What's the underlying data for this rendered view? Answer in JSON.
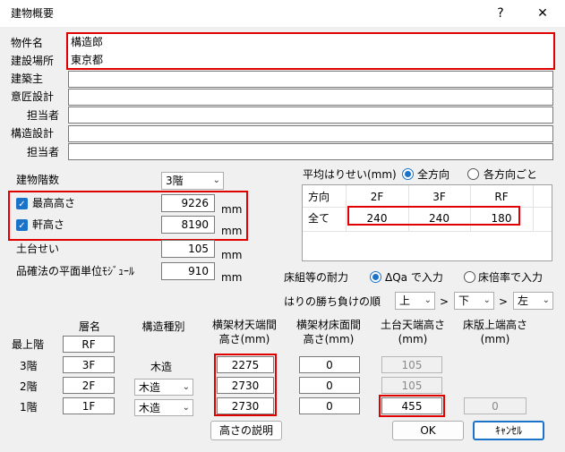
{
  "titlebar": {
    "title": "建物概要",
    "help": "?",
    "close": "✕"
  },
  "general": {
    "property_name_label": "物件名",
    "property_name_value": "構造郎",
    "location_label": "建設場所",
    "location_value": "東京都",
    "client_label": "建築主",
    "client_value": "",
    "design_label": "意匠設計",
    "design_value": "",
    "design_person_label": "担当者",
    "design_person_value": "",
    "structural_label": "構造設計",
    "structural_value": "",
    "structural_person_label": "担当者",
    "structural_person_value": ""
  },
  "building": {
    "floors_label": "建物階数",
    "floors_value": "3階",
    "max_height_label": "最高高さ",
    "max_height_value": "9226",
    "max_height_unit": "mm",
    "eave_height_label": "軒高さ",
    "eave_height_value": "8190",
    "eave_height_unit": "mm",
    "sill_label": "土台せい",
    "sill_value": "105",
    "sill_unit": "mm",
    "module_label": "品確法の平面単位ﾓｼﾞｭｰﾙ",
    "module_value": "910",
    "module_unit": "mm",
    "max_height_checked": true,
    "eave_height_checked": true
  },
  "beam_depth": {
    "label": "平均はりせい(mm)",
    "radio_all": "全方向",
    "radio_each": "各方向ごと",
    "selected": "all",
    "headers": [
      "方向",
      "2F",
      "3F",
      "RF"
    ],
    "row_label": "全て",
    "values": [
      "240",
      "240",
      "180"
    ]
  },
  "floor_strength": {
    "label": "床組等の耐力",
    "radio_qa": "ΔQa で入力",
    "radio_ratio": "床倍率で入力",
    "selected": "qa"
  },
  "beam_order": {
    "label": "はりの勝ち負けの順",
    "first": "上",
    "second": "下",
    "third": "左",
    "sep": ">"
  },
  "floors_table": {
    "col_name": "層名",
    "col_structure": "構造種別",
    "col_top": "横架材天端間\n高さ(mm)",
    "col_floor": "横架材床面間\n高さ(mm)",
    "col_sill": "土台天端高さ\n(mm)",
    "col_slab": "床版上端高さ\n(mm)",
    "rows": [
      {
        "label": "最上階",
        "name": "RF",
        "structure": "",
        "top": "",
        "floor": "",
        "sill": "",
        "slab": ""
      },
      {
        "label": "3階",
        "name": "3F",
        "structure": "木造",
        "top": "2275",
        "floor": "0",
        "sill": "105",
        "slab": ""
      },
      {
        "label": "2階",
        "name": "2F",
        "structure": "木造",
        "top": "2730",
        "floor": "0",
        "sill": "105",
        "slab": ""
      },
      {
        "label": "1階",
        "name": "1F",
        "structure": "木造",
        "top": "2730",
        "floor": "0",
        "sill": "455",
        "slab": "0"
      }
    ]
  },
  "buttons": {
    "explain": "高さの説明",
    "ok": "OK",
    "cancel": "ｷｬﾝｾﾙ"
  }
}
